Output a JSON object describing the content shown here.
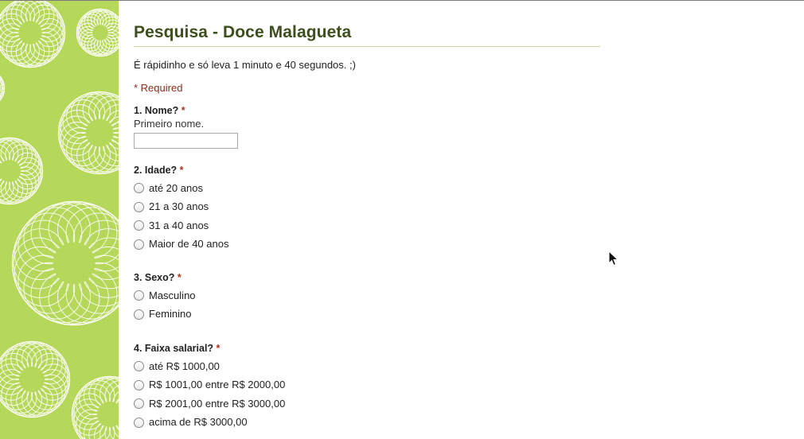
{
  "form": {
    "title": "Pesquisa - Doce Malagueta",
    "description": "É rápidinho e só leva 1 minuto e 40 segundos. ;)",
    "required_note": "* Required",
    "questions": [
      {
        "title": "1. Nome?",
        "required_mark": "*",
        "help": "Primeiro nome.",
        "type": "text",
        "value": ""
      },
      {
        "title": "2. Idade?",
        "required_mark": "*",
        "type": "radio",
        "options": [
          "até 20 anos",
          "21 a 30 anos",
          "31 a 40 anos",
          "Maior de 40 anos"
        ]
      },
      {
        "title": "3. Sexo?",
        "required_mark": "*",
        "type": "radio",
        "options": [
          "Masculino",
          "Feminino"
        ]
      },
      {
        "title": "4. Faixa salarial?",
        "required_mark": "*",
        "type": "radio",
        "options": [
          "até R$ 1000,00",
          "R$ 1001,00 entre R$ 2000,00",
          "R$ 2001,00 entre R$ 3000,00",
          "acima de R$ 3000,00"
        ]
      }
    ]
  },
  "colors": {
    "sidebar_green": "#b6d85a",
    "title_green": "#3d4f1d",
    "required_red": "#b0311c"
  },
  "icons": {
    "sidebar_pattern": "spirograph-flower-pattern",
    "cursor": "mouse-pointer-arrow"
  }
}
